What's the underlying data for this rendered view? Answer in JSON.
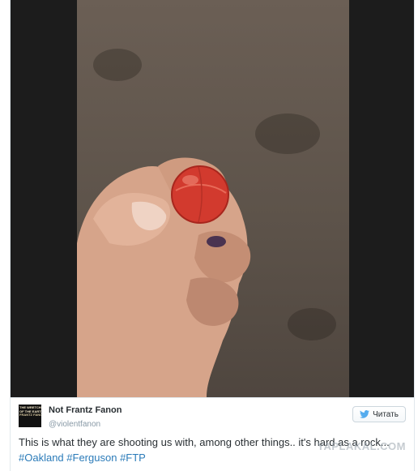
{
  "tweet": {
    "display_name": "Not Frantz Fanon",
    "username": "@violentfanon",
    "avatar_text": [
      "THE WRETCHED",
      "OF THE EARTH",
      "FRANTZ FANON"
    ],
    "follow_label": "Читать",
    "text": "This is what they are shooting us with, among other things.. it's hard as a rock...",
    "hashtags": [
      "#Oakland",
      "#Ferguson",
      "#FTP"
    ]
  },
  "photo": {
    "subject-icon": "hand-holding-red-ball"
  },
  "watermark": "YAPLAKAL.COM",
  "colors": {
    "link": "#2b7bb9",
    "text": "#292f33",
    "muted": "#8899a6",
    "ball": "#d23a2e"
  }
}
